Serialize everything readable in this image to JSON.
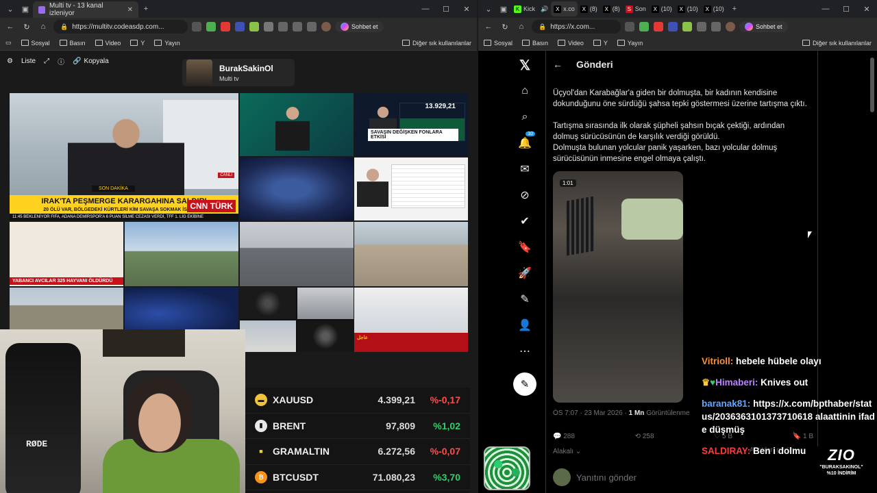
{
  "left_window": {
    "tab_title": "Multi tv - 13 kanal izleniyor",
    "url": "https://multitv.codeasdp.com...",
    "chat_button": "Sohbet et",
    "bookmarks": [
      "Sosyal",
      "Basın",
      "Video",
      "Y",
      "Yayın"
    ],
    "other_bookmarks": "Diğer sık kullanılanlar"
  },
  "right_window": {
    "tabs": [
      "Kick",
      "x.co",
      "(8)",
      "(8)",
      "Son",
      "(10)",
      "(10)",
      "(10)"
    ],
    "url": "https://x.com...",
    "chat_button": "Sohbet et",
    "bookmarks": [
      "Sosyal",
      "Basın",
      "Video",
      "Y",
      "Yayın"
    ],
    "other_bookmarks": "Diğer sık kullanılanlar"
  },
  "multitv": {
    "controls": [
      "Liste",
      "Kopyala"
    ],
    "channel": {
      "name": "BurakSakinOl",
      "subtitle": "Multi tv"
    },
    "main_feed": {
      "son_dakika": "SON DAKİKA",
      "headline": "IRAK'TA PEŞMERGE KARARGAHINA SALDIRI",
      "subline": "20 ÖLÜ VAR, BÖLGEDEKİ KÜRTLERİ KİM SAVAŞA SOKMAK İSTİYOR?",
      "ticker": "11:45 BEKLENİYOR    FIFA, ADANA DEMİRSPOR'A 6 PUAN SİLME CEZASI VERDİ, TFF 1. LİG EKİBİNE",
      "live": "CANLI",
      "logo": "CNN TÜRK"
    },
    "feed_3": {
      "bar": "SAVAŞIN DEĞİŞKEN FONLARA ETKİSİ",
      "index": "13.929,21"
    },
    "feed_6_label": "YABANCI AVCILAR 325 HAYVANI ÖLDÜRDÜ",
    "feed_13_label": "عاجل"
  },
  "prices": [
    {
      "symbol": "XAUUSD",
      "value": "4.399,21",
      "change": "%-0,17",
      "dir": "neg",
      "icon_color": "#f0c23a",
      "icon": "gold-bars-icon"
    },
    {
      "symbol": "BRENT",
      "value": "97,809",
      "change": "%1,02",
      "dir": "pos",
      "icon_color": "#e8e8e8",
      "icon": "oil-barrel-icon"
    },
    {
      "symbol": "GRAMALTIN",
      "value": "6.272,56",
      "change": "%-0,07",
      "dir": "neg",
      "icon_color": "#f0d23a",
      "icon": "gold-square-icon"
    },
    {
      "symbol": "BTCUSDT",
      "value": "71.080,23",
      "change": "%3,70",
      "dir": "pos",
      "icon_color": "#f7931a",
      "icon": "bitcoin-icon"
    }
  ],
  "webcam": {
    "mic_brand": "RØDE"
  },
  "x": {
    "header": "Gönderi",
    "notifications_badge": "10",
    "paragraphs": [
      "Üçyol'dan Karabağlar'a giden bir dolmuşta, bir kadının kendisine dokunduğunu öne sürdüğü şahsa tepki göstermesi üzerine tartışma çıktı.",
      "Tartışma sırasında ilk olarak şüpheli şahsın bıçak çektiği, ardından dolmuş sürücüsünün de karşılık verdiği görüldü.",
      "Dolmuşta bulunan yolcular panik yaşarken, bazı yolcular dolmuş sürücüsünün inmesine engel olmaya çalıştı."
    ],
    "video_time": "1:01",
    "timestamp": "ÖS 7:07 · 23 Mar 2026 · ",
    "views_count": "1 Mn",
    "views_label": "Görüntülenme",
    "replies": "288",
    "reposts": "258",
    "likes": "5 B",
    "bookmarks": "1 B",
    "relevant": "Alakalı",
    "reply_placeholder": "Yanıtını gönder"
  },
  "chat": [
    {
      "user": "Vitrioll:",
      "text": "hebele hübele olayı",
      "color": "u1",
      "badges": ""
    },
    {
      "user": "Himaberi:",
      "text": "Knives out",
      "color": "u2",
      "badges": "♛♥"
    },
    {
      "user": "baranak81:",
      "text": "https://x.com/bpthaber/status/2036363101373710618 alaattinin ifade düşmüş",
      "color": "u3",
      "badges": ""
    },
    {
      "user": "SALDIRAY:",
      "text": "Ben i dolmuşçu hakl",
      "color": "u4",
      "badges": ""
    }
  ],
  "promo": {
    "brand": "ZIO",
    "line1": "\"BURAKSAKINOL\"",
    "line2": "%10 İNDİRİM"
  },
  "x_overlay_hint": "Alıntıları görün"
}
